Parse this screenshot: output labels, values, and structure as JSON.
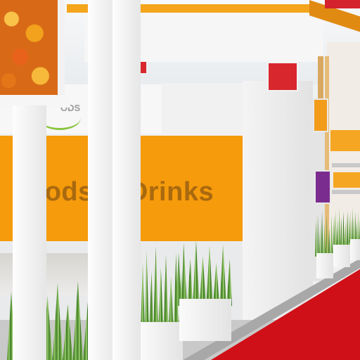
{
  "scene": {
    "description_label": "exhibition booth",
    "wall_text": "oods & Drinks",
    "logo_text": "ODS"
  },
  "colors": {
    "orange": "#f59b0c",
    "red_carpet": "#d01018",
    "white": "#f4f4f4",
    "grass_green": "#6aa443"
  },
  "icons": [
    "fruit-photo",
    "logo-swoosh",
    "planter-grass"
  ]
}
